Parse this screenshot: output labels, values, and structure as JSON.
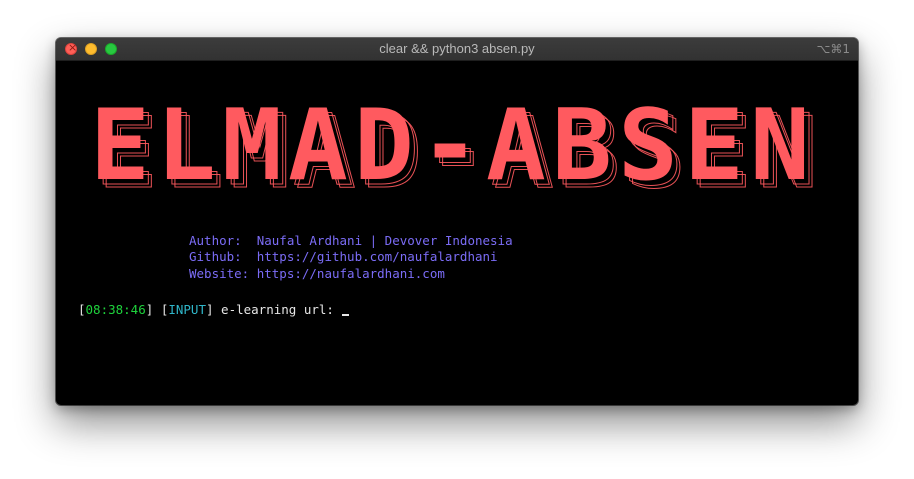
{
  "window": {
    "title": "clear && python3 absen.py",
    "shortcut": "⌥⌘1"
  },
  "banner": {
    "text": "ELMAD-ABSEN",
    "color": "#ff5a5f"
  },
  "info": {
    "author": "Author:  Naufal Ardhani | Devover Indonesia",
    "github": "Github:  https://github.com/naufalardhani",
    "website": "Website: https://naufalardhani.com",
    "color": "#7b6cf6"
  },
  "prompt": {
    "open_bracket_1": "[",
    "time": "08:38:46",
    "close_bracket_1": "] ",
    "open_bracket_2": "[",
    "tag": "INPUT",
    "close_bracket_2": "] ",
    "label": "e-learning url: "
  },
  "icons": {
    "close": "close-traffic-light",
    "minimize": "minimize-traffic-light",
    "maximize": "maximize-traffic-light"
  }
}
